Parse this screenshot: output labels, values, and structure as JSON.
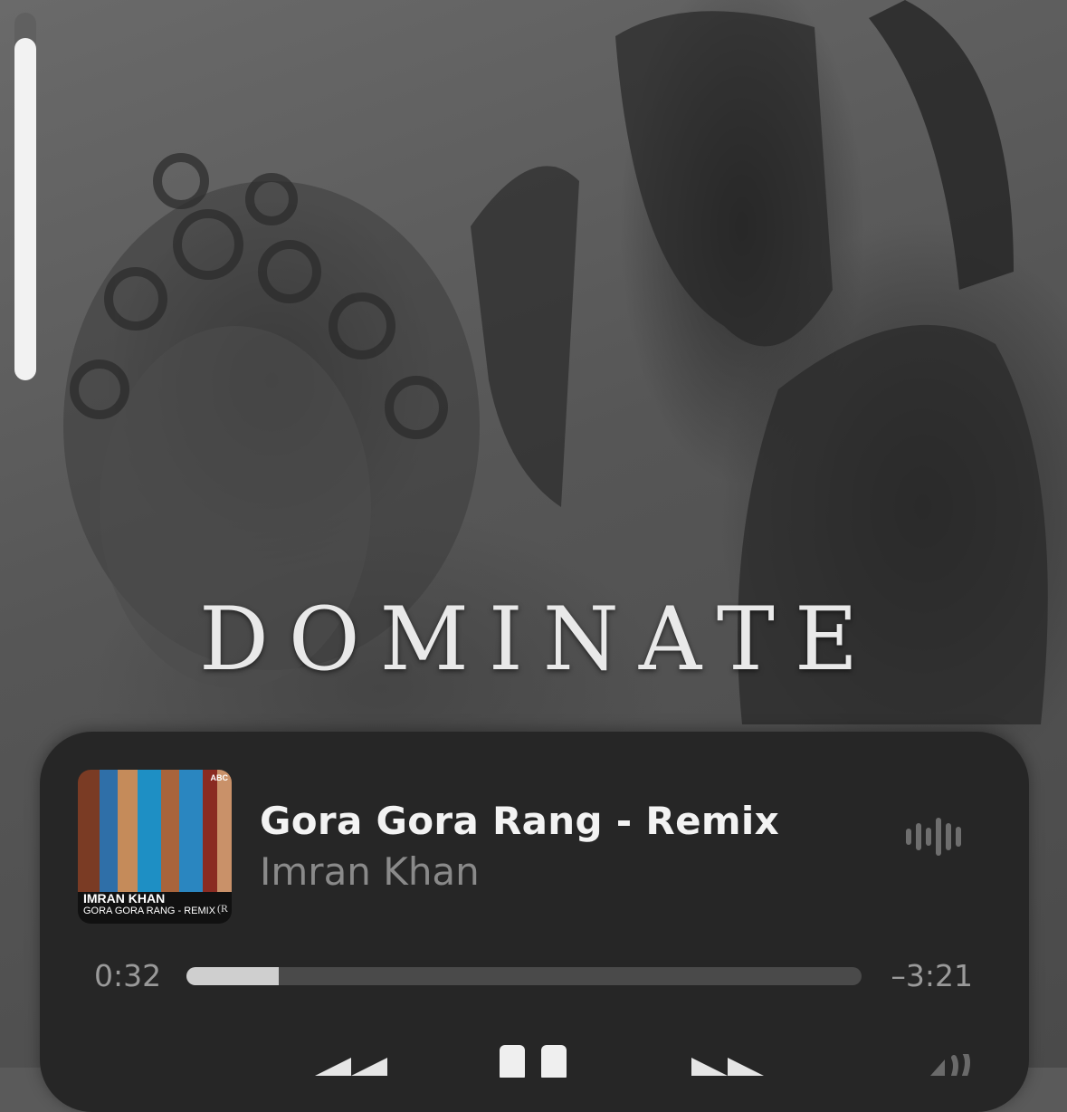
{
  "artwork_background": {
    "title_text": "DOMINATE"
  },
  "volume": {
    "level": 0.93
  },
  "now_playing": {
    "title": "Gora Gora Rang - Remix",
    "artist": "Imran Khan",
    "album_art": {
      "artist_text": "IMRAN KHAN",
      "title_text": "GORA GORA RANG - REMIX",
      "label_text": "ABC",
      "mark_text": "(R"
    },
    "elapsed": "0:32",
    "remaining": "–3:21",
    "progress": 0.137
  },
  "controls": {
    "previous_icon": "rewind-icon",
    "play_pause_icon": "pause-icon",
    "next_icon": "fast-forward-icon",
    "volume_icon": "speaker-icon",
    "waveform_icon": "waveform-icon"
  },
  "colors": {
    "card_bg": "#262626",
    "progress_fill": "#cfcfcf",
    "progress_track": "#4a4a4a",
    "secondary_text": "#8a8a8a"
  }
}
